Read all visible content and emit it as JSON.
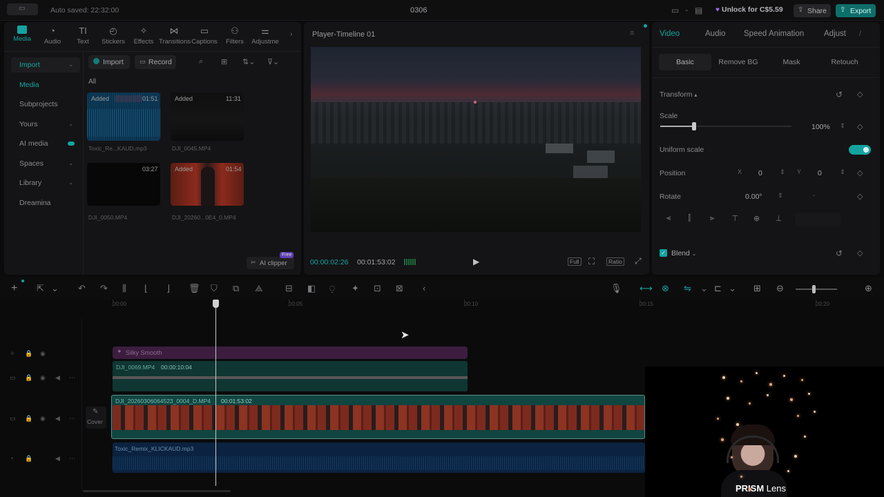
{
  "titlebar": {
    "autosave": "Auto saved: 22:32:00",
    "project": "0306",
    "unlock": "Unlock for C$5.59",
    "share": "Share",
    "export": "Export"
  },
  "toolbar": [
    {
      "label": "Media",
      "icon": "▣",
      "active": true
    },
    {
      "label": "Audio",
      "icon": "◔"
    },
    {
      "label": "Text",
      "icon": "TI"
    },
    {
      "label": "Stickers",
      "icon": "◴"
    },
    {
      "label": "Effects",
      "icon": "✧"
    },
    {
      "label": "Transitions",
      "icon": "⋈"
    },
    {
      "label": "Captions",
      "icon": "▭"
    },
    {
      "label": "Filters",
      "icon": "⚇"
    },
    {
      "label": "Adjustme",
      "icon": "⚌"
    }
  ],
  "sidebar": [
    {
      "label": "Import",
      "chevron": "⌄"
    },
    {
      "label": "Media",
      "chevron": ""
    },
    {
      "label": "Subprojects",
      "chevron": ""
    },
    {
      "label": "Yours",
      "chevron": "⌄"
    },
    {
      "label": "AI media",
      "chevron": ""
    },
    {
      "label": "Spaces",
      "chevron": "⌄"
    },
    {
      "label": "Library",
      "chevron": "⌄"
    },
    {
      "label": "Dreamina",
      "chevron": ""
    }
  ],
  "media": {
    "import_label": "Import",
    "record_label": "Record",
    "section": "All",
    "items": [
      {
        "badge": "Added",
        "duration": "01:51",
        "name": "Toxic_Re...KAUD.mp3"
      },
      {
        "badge": "Added",
        "duration": "11:31",
        "name": "DJI_0045.MP4"
      },
      {
        "badge": "",
        "duration": "03:27",
        "name": "DJI_0050.MP4"
      },
      {
        "badge": "Added",
        "duration": "01:54",
        "name": "DJI_20260...0E4_0.MP4"
      }
    ],
    "ai_clipper": "AI clipper",
    "ai_badge": "Free"
  },
  "player": {
    "title": "Player-Timeline 01",
    "current": "00:00:02:26",
    "total": "00:01:53:02",
    "full": "Full",
    "ratio": "Ratio"
  },
  "props": {
    "tabs": [
      "Video",
      "Audio",
      "Speed",
      "Animation",
      "Adjust"
    ],
    "subtabs": [
      "Basic",
      "Remove BG",
      "Mask",
      "Retouch"
    ],
    "transform": "Transform",
    "scale_label": "Scale",
    "scale_value": "100%",
    "scale_level": 0.26,
    "uniform": "Uniform scale",
    "position_label": "Position",
    "x_label": "X",
    "x_value": "0",
    "y_label": "Y",
    "y_value": "0",
    "rotate_label": "Rotate",
    "rotate_value": "0.00°",
    "blend": "Blend"
  },
  "timeline": {
    "ruler": [
      "00:00",
      "00:05",
      "00:10",
      "00:15",
      "00:20"
    ],
    "effect_clip": "Silky Smooth",
    "clip1_name": "DJI_0069.MP4",
    "clip1_dur": "00:00:10:04",
    "clip2_name": "DJI_20260306064523_0004_D.MP4",
    "clip2_dur": "00:01:53:02",
    "cover": "Cover",
    "audio_clip": "Toxic_Remix_KLICKAUD.mp3"
  },
  "webcam": {
    "brand_bold": "PRISM",
    "brand_light": " Lens"
  }
}
